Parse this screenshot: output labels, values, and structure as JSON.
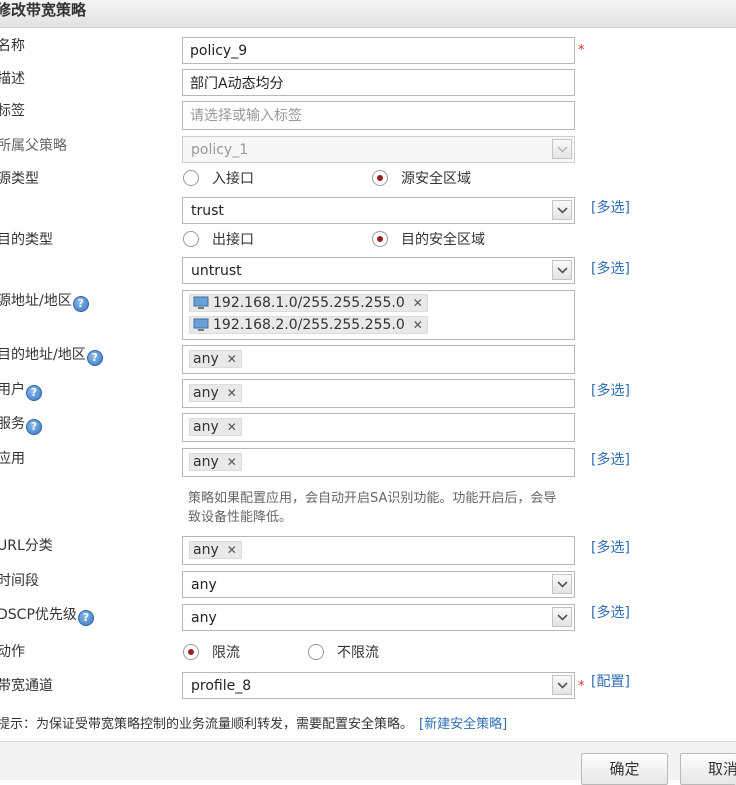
{
  "dialog": {
    "title": "修改带宽策略"
  },
  "form": {
    "name": {
      "label": "名称",
      "value": "policy_9",
      "required": "*"
    },
    "description": {
      "label": "描述",
      "value": "部门A动态均分"
    },
    "tags": {
      "label": "标签",
      "placeholder": "请选择或输入标签"
    },
    "parent_policy": {
      "label": "所属父策略",
      "value": "policy_1"
    },
    "source_type": {
      "label": "源类型",
      "options": [
        "入接口",
        "源安全区域"
      ],
      "selected": "源安全区域",
      "zone": "trust",
      "multi_link": "[多选]"
    },
    "dest_type": {
      "label": "目的类型",
      "options": [
        "出接口",
        "目的安全区域"
      ],
      "selected": "目的安全区域",
      "zone": "untrust",
      "multi_link": "[多选]"
    },
    "source_address": {
      "label": "源地址/地区",
      "items": [
        "192.168.1.0/255.255.255.0",
        "192.168.2.0/255.255.255.0"
      ]
    },
    "dest_address": {
      "label": "目的地址/地区",
      "items": [
        "any"
      ]
    },
    "user": {
      "label": "用户",
      "items": [
        "any"
      ],
      "multi_link": "[多选]"
    },
    "service": {
      "label": "服务",
      "items": [
        "any"
      ]
    },
    "application": {
      "label": "应用",
      "items": [
        "any"
      ],
      "multi_link": "[多选]",
      "note": "策略如果配置应用，会自动开启SA识别功能。功能开启后，会导致设备性能降低。"
    },
    "url_category": {
      "label": "URL分类",
      "items": [
        "any"
      ],
      "multi_link": "[多选]"
    },
    "time_range": {
      "label": "时间段",
      "value": "any"
    },
    "dscp": {
      "label": "DSCP优先级",
      "value": "any",
      "multi_link": "[多选]"
    },
    "action": {
      "label": "动作",
      "options": [
        "限流",
        "不限流"
      ],
      "selected": "限流"
    },
    "bandwidth_channel": {
      "label": "带宽通道",
      "value": "profile_8",
      "required": "*",
      "config_link": "[配置]"
    }
  },
  "footer": {
    "tip": "提示：为保证受带宽策略控制的业务流量顺利转发，需要配置安全策略。",
    "tip_link": "[新建安全策略]",
    "ok_label": "确定",
    "cancel_label": "取消"
  },
  "icons": {
    "help": "question-circle-icon",
    "remove": "close-icon",
    "address": "computer-icon",
    "dropdown": "chevron-down-icon"
  }
}
